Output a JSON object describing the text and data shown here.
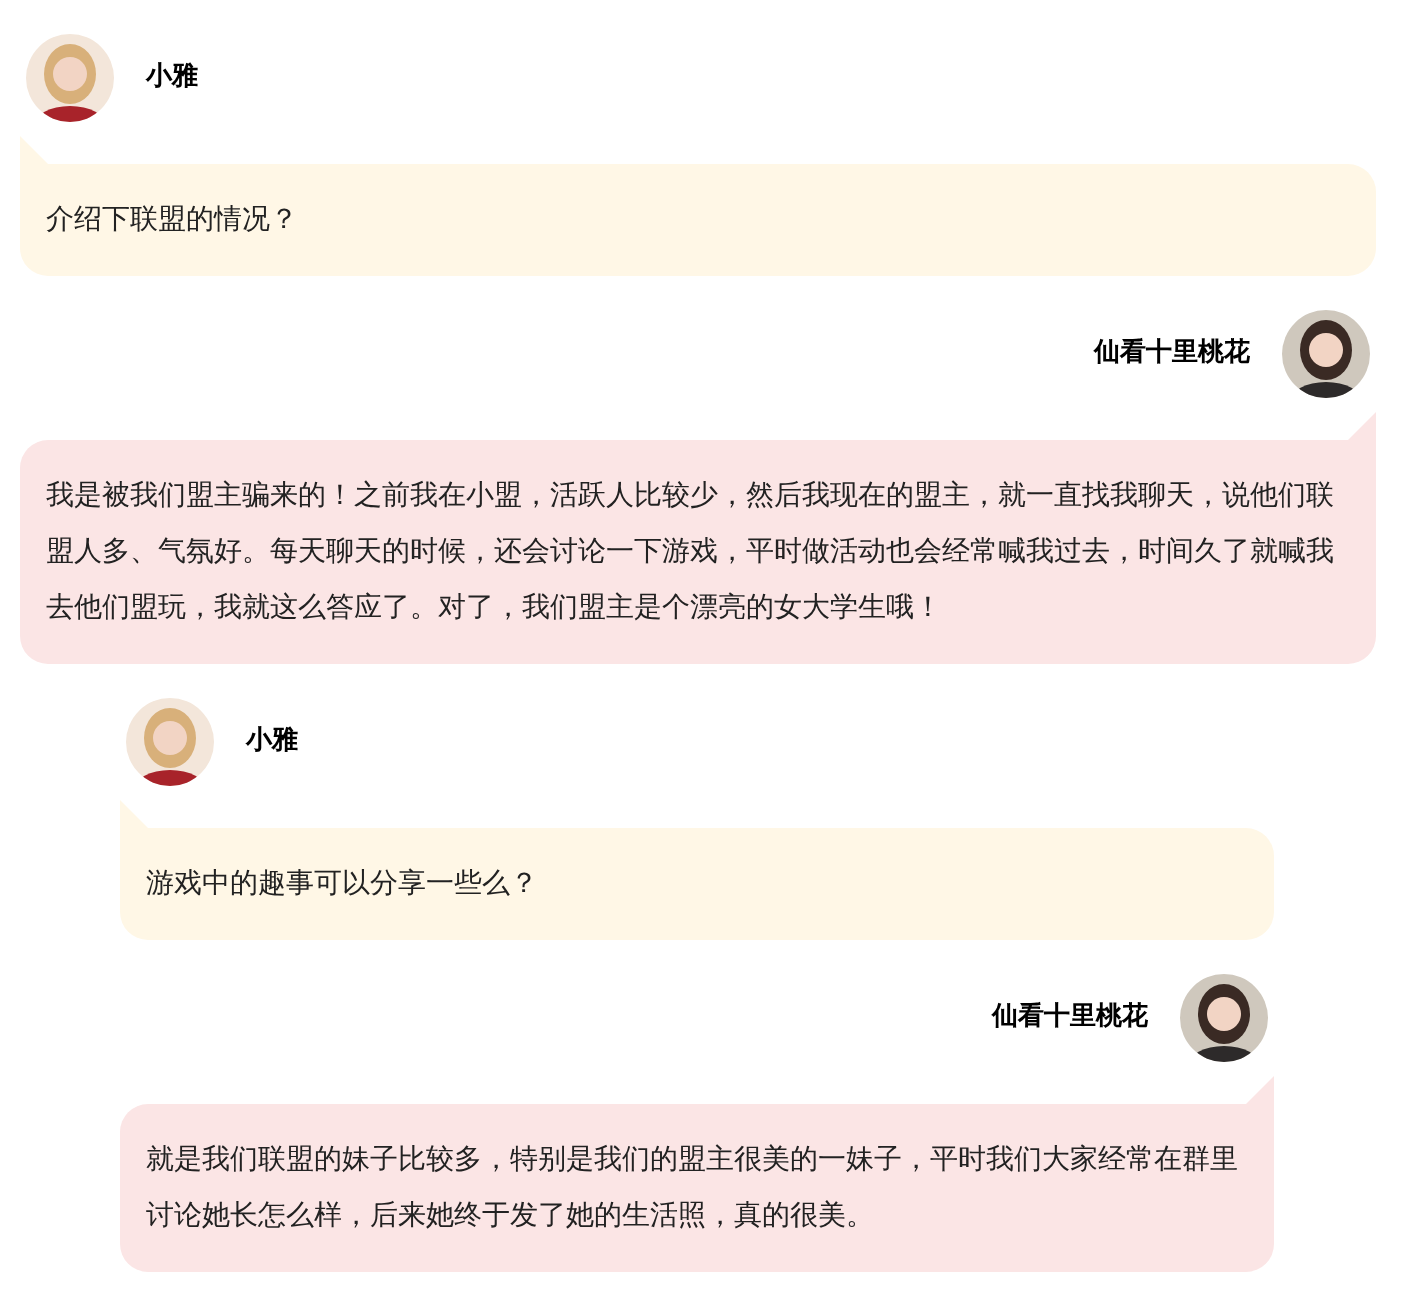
{
  "groups": [
    {
      "messages": [
        {
          "kind": "left",
          "name": "小雅",
          "text": "介绍下联盟的情况？"
        },
        {
          "kind": "right",
          "name": "仙看十里桃花",
          "text": "我是被我们盟主骗来的！之前我在小盟，活跃人比较少，然后我现在的盟主，就一直找我聊天，说他们联盟人多、气氛好。每天聊天的时候，还会讨论一下游戏，平时做活动也会经常喊我过去，时间久了就喊我去他们盟玩，我就这么答应了。对了，我们盟主是个漂亮的女大学生哦！"
        }
      ]
    },
    {
      "messages": [
        {
          "kind": "left",
          "name": "小雅",
          "text": "游戏中的趣事可以分享一些么？"
        },
        {
          "kind": "right",
          "name": "仙看十里桃花",
          "text": "就是我们联盟的妹子比较多，特别是我们的盟主很美的一妹子，平时我们大家经常在群里讨论她长怎么样，后来她终于发了她的生活照，真的很美。"
        }
      ]
    }
  ]
}
